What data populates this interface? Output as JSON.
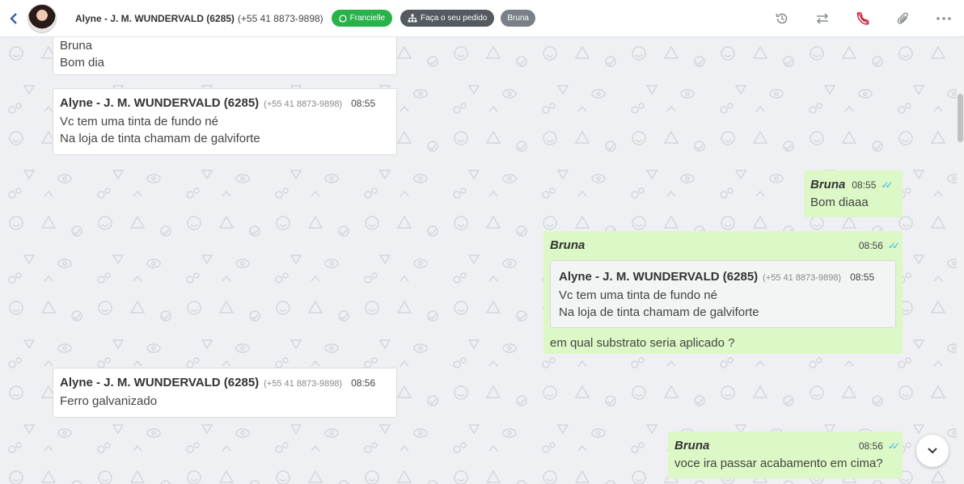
{
  "header": {
    "contact_name": "Alyne - J. M. WUNDERVALD (6285)",
    "contact_phone": "(+55 41 8873-9898)",
    "tags": [
      {
        "label": "Francielle",
        "icon": "whatsapp-icon",
        "color": "#27b24a"
      },
      {
        "label": "Faça o seu pedido",
        "icon": "sitemap-icon",
        "color": "#555a60"
      },
      {
        "label": "Bruna",
        "color": "#7b8088"
      }
    ],
    "actions": [
      "history-icon",
      "transfer-icon",
      "end-call-icon",
      "attach-icon",
      "more-icon"
    ]
  },
  "messages": [
    {
      "direction": "in",
      "lines": [
        "Bruna",
        "Bom dia"
      ]
    },
    {
      "direction": "in",
      "sender": "Alyne - J. M. WUNDERVALD (6285)",
      "phone": "(+55 41 8873-9898)",
      "time": "08:55",
      "lines": [
        "Vc tem uma tinta de fundo né",
        "Na loja de tinta chamam de galviforte"
      ]
    },
    {
      "direction": "out",
      "sender": "Bruna",
      "time": "08:55",
      "lines": [
        "Bom diaaa"
      ]
    },
    {
      "direction": "out",
      "sender": "Bruna",
      "time": "08:56",
      "quote": {
        "sender": "Alyne - J. M. WUNDERVALD (6285)",
        "phone": "(+55 41 8873-9898)",
        "time": "08:55",
        "lines": [
          "Vc tem uma tinta de fundo né",
          "Na loja de tinta chamam de galviforte"
        ]
      },
      "text": "em qual substrato seria aplicado ?"
    },
    {
      "direction": "in",
      "sender": "Alyne - J. M. WUNDERVALD (6285)",
      "phone": "(+55 41 8873-9898)",
      "time": "08:56",
      "lines": [
        "Ferro galvanizado"
      ]
    },
    {
      "direction": "out",
      "sender": "Bruna",
      "time": "08:56",
      "lines": [
        "voce ira passar acabamento em cima?"
      ]
    }
  ],
  "colors": {
    "incoming": "#ffffff",
    "outgoing": "#dcf8c6",
    "read_ticks": "#34b7f1",
    "background": "#eef0f3"
  }
}
